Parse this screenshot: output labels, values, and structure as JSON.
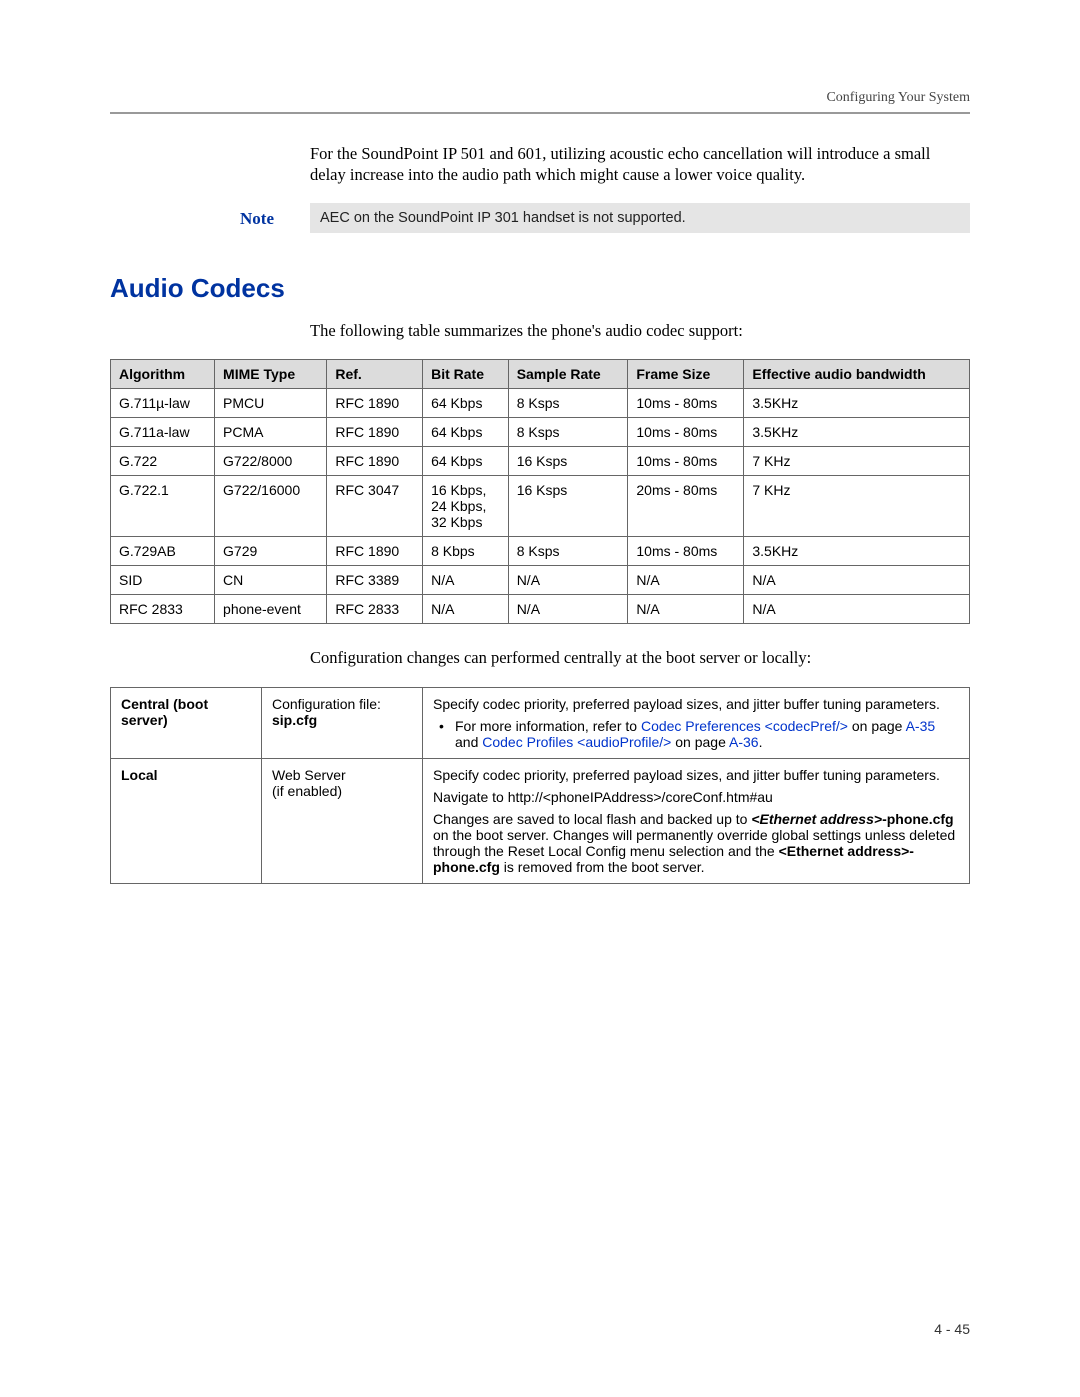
{
  "running_head": "Configuring Your System",
  "intro_para": "For the SoundPoint IP 501 and 601, utilizing acoustic echo cancellation will introduce a small delay increase into the audio path which might cause a lower voice quality.",
  "note_label": "Note",
  "note_text": "AEC on the SoundPoint IP 301 handset is not supported.",
  "section_title": "Audio Codecs",
  "table_intro": "The following table summarizes the phone's audio codec support:",
  "codec_headers": {
    "algorithm": "Algorithm",
    "mime": "MIME Type",
    "ref": "Ref.",
    "bitrate": "Bit Rate",
    "sample": "Sample Rate",
    "framesize": "Frame Size",
    "bandwidth": "Effective audio bandwidth"
  },
  "codec_rows": [
    {
      "algorithm": "G.711µ-law",
      "mime": "PMCU",
      "ref": "RFC 1890",
      "bitrate": "64 Kbps",
      "sample": "8 Ksps",
      "framesize": "10ms - 80ms",
      "bandwidth": "3.5KHz"
    },
    {
      "algorithm": "G.711a-law",
      "mime": "PCMA",
      "ref": "RFC 1890",
      "bitrate": "64 Kbps",
      "sample": "8 Ksps",
      "framesize": "10ms - 80ms",
      "bandwidth": "3.5KHz"
    },
    {
      "algorithm": "G.722",
      "mime": "G722/8000",
      "ref": "RFC 1890",
      "bitrate": "64 Kbps",
      "sample": "16 Ksps",
      "framesize": "10ms - 80ms",
      "bandwidth": "7 KHz"
    },
    {
      "algorithm": "G.722.1",
      "mime": "G722/16000",
      "ref": "RFC 3047",
      "bitrate": "16 Kbps, 24 Kbps, 32 Kbps",
      "sample": "16 Ksps",
      "framesize": "20ms - 80ms",
      "bandwidth": "7 KHz"
    },
    {
      "algorithm": "G.729AB",
      "mime": "G729",
      "ref": "RFC 1890",
      "bitrate": "8 Kbps",
      "sample": "8 Ksps",
      "framesize": "10ms - 80ms",
      "bandwidth": "3.5KHz"
    },
    {
      "algorithm": "SID",
      "mime": "CN",
      "ref": "RFC 3389",
      "bitrate": "N/A",
      "sample": "N/A",
      "framesize": "N/A",
      "bandwidth": "N/A"
    },
    {
      "algorithm": "RFC 2833",
      "mime": "phone-event",
      "ref": "RFC 2833",
      "bitrate": "N/A",
      "sample": "N/A",
      "framesize": "N/A",
      "bandwidth": "N/A"
    }
  ],
  "config_intro": "Configuration changes can performed centrally at the boot server or locally:",
  "config_central": {
    "label": "Central (boot server)",
    "method_line1": "Configuration file:",
    "method_file": "sip.cfg",
    "desc_intro": "Specify codec priority, preferred payload sizes, and jitter buffer tuning parameters.",
    "bullet_pre": "For more information, refer to ",
    "link1": "Codec Preferences <codecPref/>",
    "bullet_mid": " on page ",
    "page1": "A-35",
    "bullet_and": " and ",
    "link2": "Codec Profiles <audioProfile/>",
    "bullet_post": " on page ",
    "page2": "A-36",
    "bullet_end": "."
  },
  "config_local": {
    "label": "Local",
    "method_line1": "Web Server",
    "method_line2": "(if enabled)",
    "desc1": "Specify codec priority, preferred payload sizes, and jitter buffer tuning parameters.",
    "desc2": "Navigate to http://<phoneIPAddress>/coreConf.htm#au",
    "desc3_pre": "Changes are saved to local flash and backed up to ",
    "desc3_bi1": "<Ethernet address>",
    "desc3_b1": "-phone.cfg",
    "desc3_mid": " on the boot server. Changes will permanently override global settings unless deleted through the Reset Local Config menu selection and the ",
    "desc3_b2": "<Ethernet address>-phone.cfg",
    "desc3_post": " is removed from the boot server."
  },
  "page_number": "4 - 45"
}
